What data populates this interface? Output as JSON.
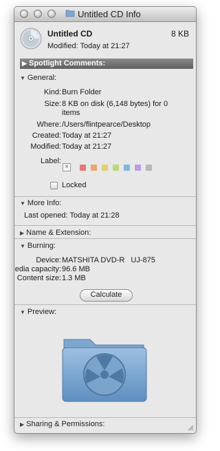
{
  "window": {
    "title": "Untitled CD Info"
  },
  "header": {
    "name": "Untitled CD",
    "size": "8 KB",
    "modified": "Modified: Today at 21:27"
  },
  "spotlight": {
    "label": "Spotlight Comments:"
  },
  "general": {
    "heading": "General:",
    "kind_label": "Kind:",
    "kind_value": "Burn Folder",
    "size_label": "Size:",
    "size_value_1": "8 KB on disk (6,148 bytes) for 0",
    "size_value_2": "items",
    "where_label": "Where:",
    "where_value": "/Users/flintpearce/Desktop",
    "created_label": "Created:",
    "created_value": "Today at 21:27",
    "modified_label": "Modified:",
    "modified_value": "Today at 21:27",
    "label_label": "Label:",
    "label_colors": [
      "#e27a7a",
      "#e6a870",
      "#e0d070",
      "#b9d878",
      "#80b8e0",
      "#b8a0e0",
      "#b8b8b8"
    ],
    "locked_label": "Locked"
  },
  "more_info": {
    "heading": "More Info:",
    "last_opened": "Last opened: Today at 21:28"
  },
  "name_ext": {
    "heading": "Name & Extension:"
  },
  "burning": {
    "heading": "Burning:",
    "device_label": "Device:",
    "device_value": "MATSHITA DVD-R   UJ-875",
    "capacity_label": "Media capacity:",
    "capacity_value": "96.6 MB",
    "content_label": "Content size:",
    "content_value": "1.3 MB",
    "calculate_label": "Calculate"
  },
  "preview": {
    "heading": "Preview:"
  },
  "sharing": {
    "heading": "Sharing & Permissions:"
  }
}
